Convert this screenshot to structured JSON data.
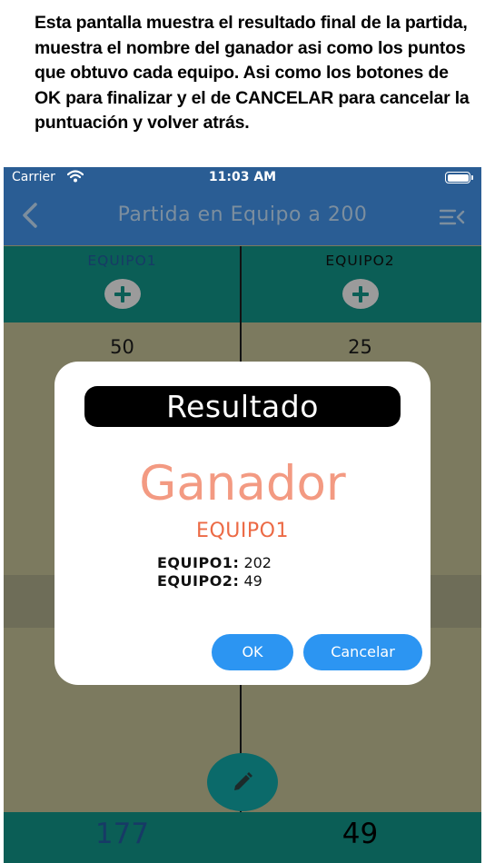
{
  "caption": "Esta pantalla muestra el resultado final de la partida, muestra el nombre del ganador asi como los puntos que obtuvo cada equipo. Asi como los botones de OK para finalizar y el de CANCELAR para cancelar la puntuación y volver atrás.",
  "status_bar": {
    "carrier": "Carrier",
    "time": "11:03 AM"
  },
  "nav": {
    "title": "Partida en Equipo a 200",
    "back_icon": "chevron-left-icon",
    "menu_icon": "menu-collapse-icon"
  },
  "teams": [
    {
      "name": "EQUIPO1",
      "score": "50",
      "total": "177"
    },
    {
      "name": "EQUIPO2",
      "score": "25",
      "total": "49"
    }
  ],
  "dialog": {
    "title": "Resultado",
    "winner_label": "Ganador",
    "winner_name": "EQUIPO1",
    "results": [
      {
        "label": "EQUIPO1:",
        "value": "202"
      },
      {
        "label": "EQUIPO2:",
        "value": "49"
      }
    ],
    "ok_label": "OK",
    "cancel_label": "Cancelar"
  },
  "colors": {
    "nav_background": "#2a5d94",
    "team_header": "#0b5e56",
    "overlay": "#7c7a5f",
    "winner_label": "#f39a82",
    "winner_name": "#ec6a45",
    "button": "#2c95f2"
  }
}
